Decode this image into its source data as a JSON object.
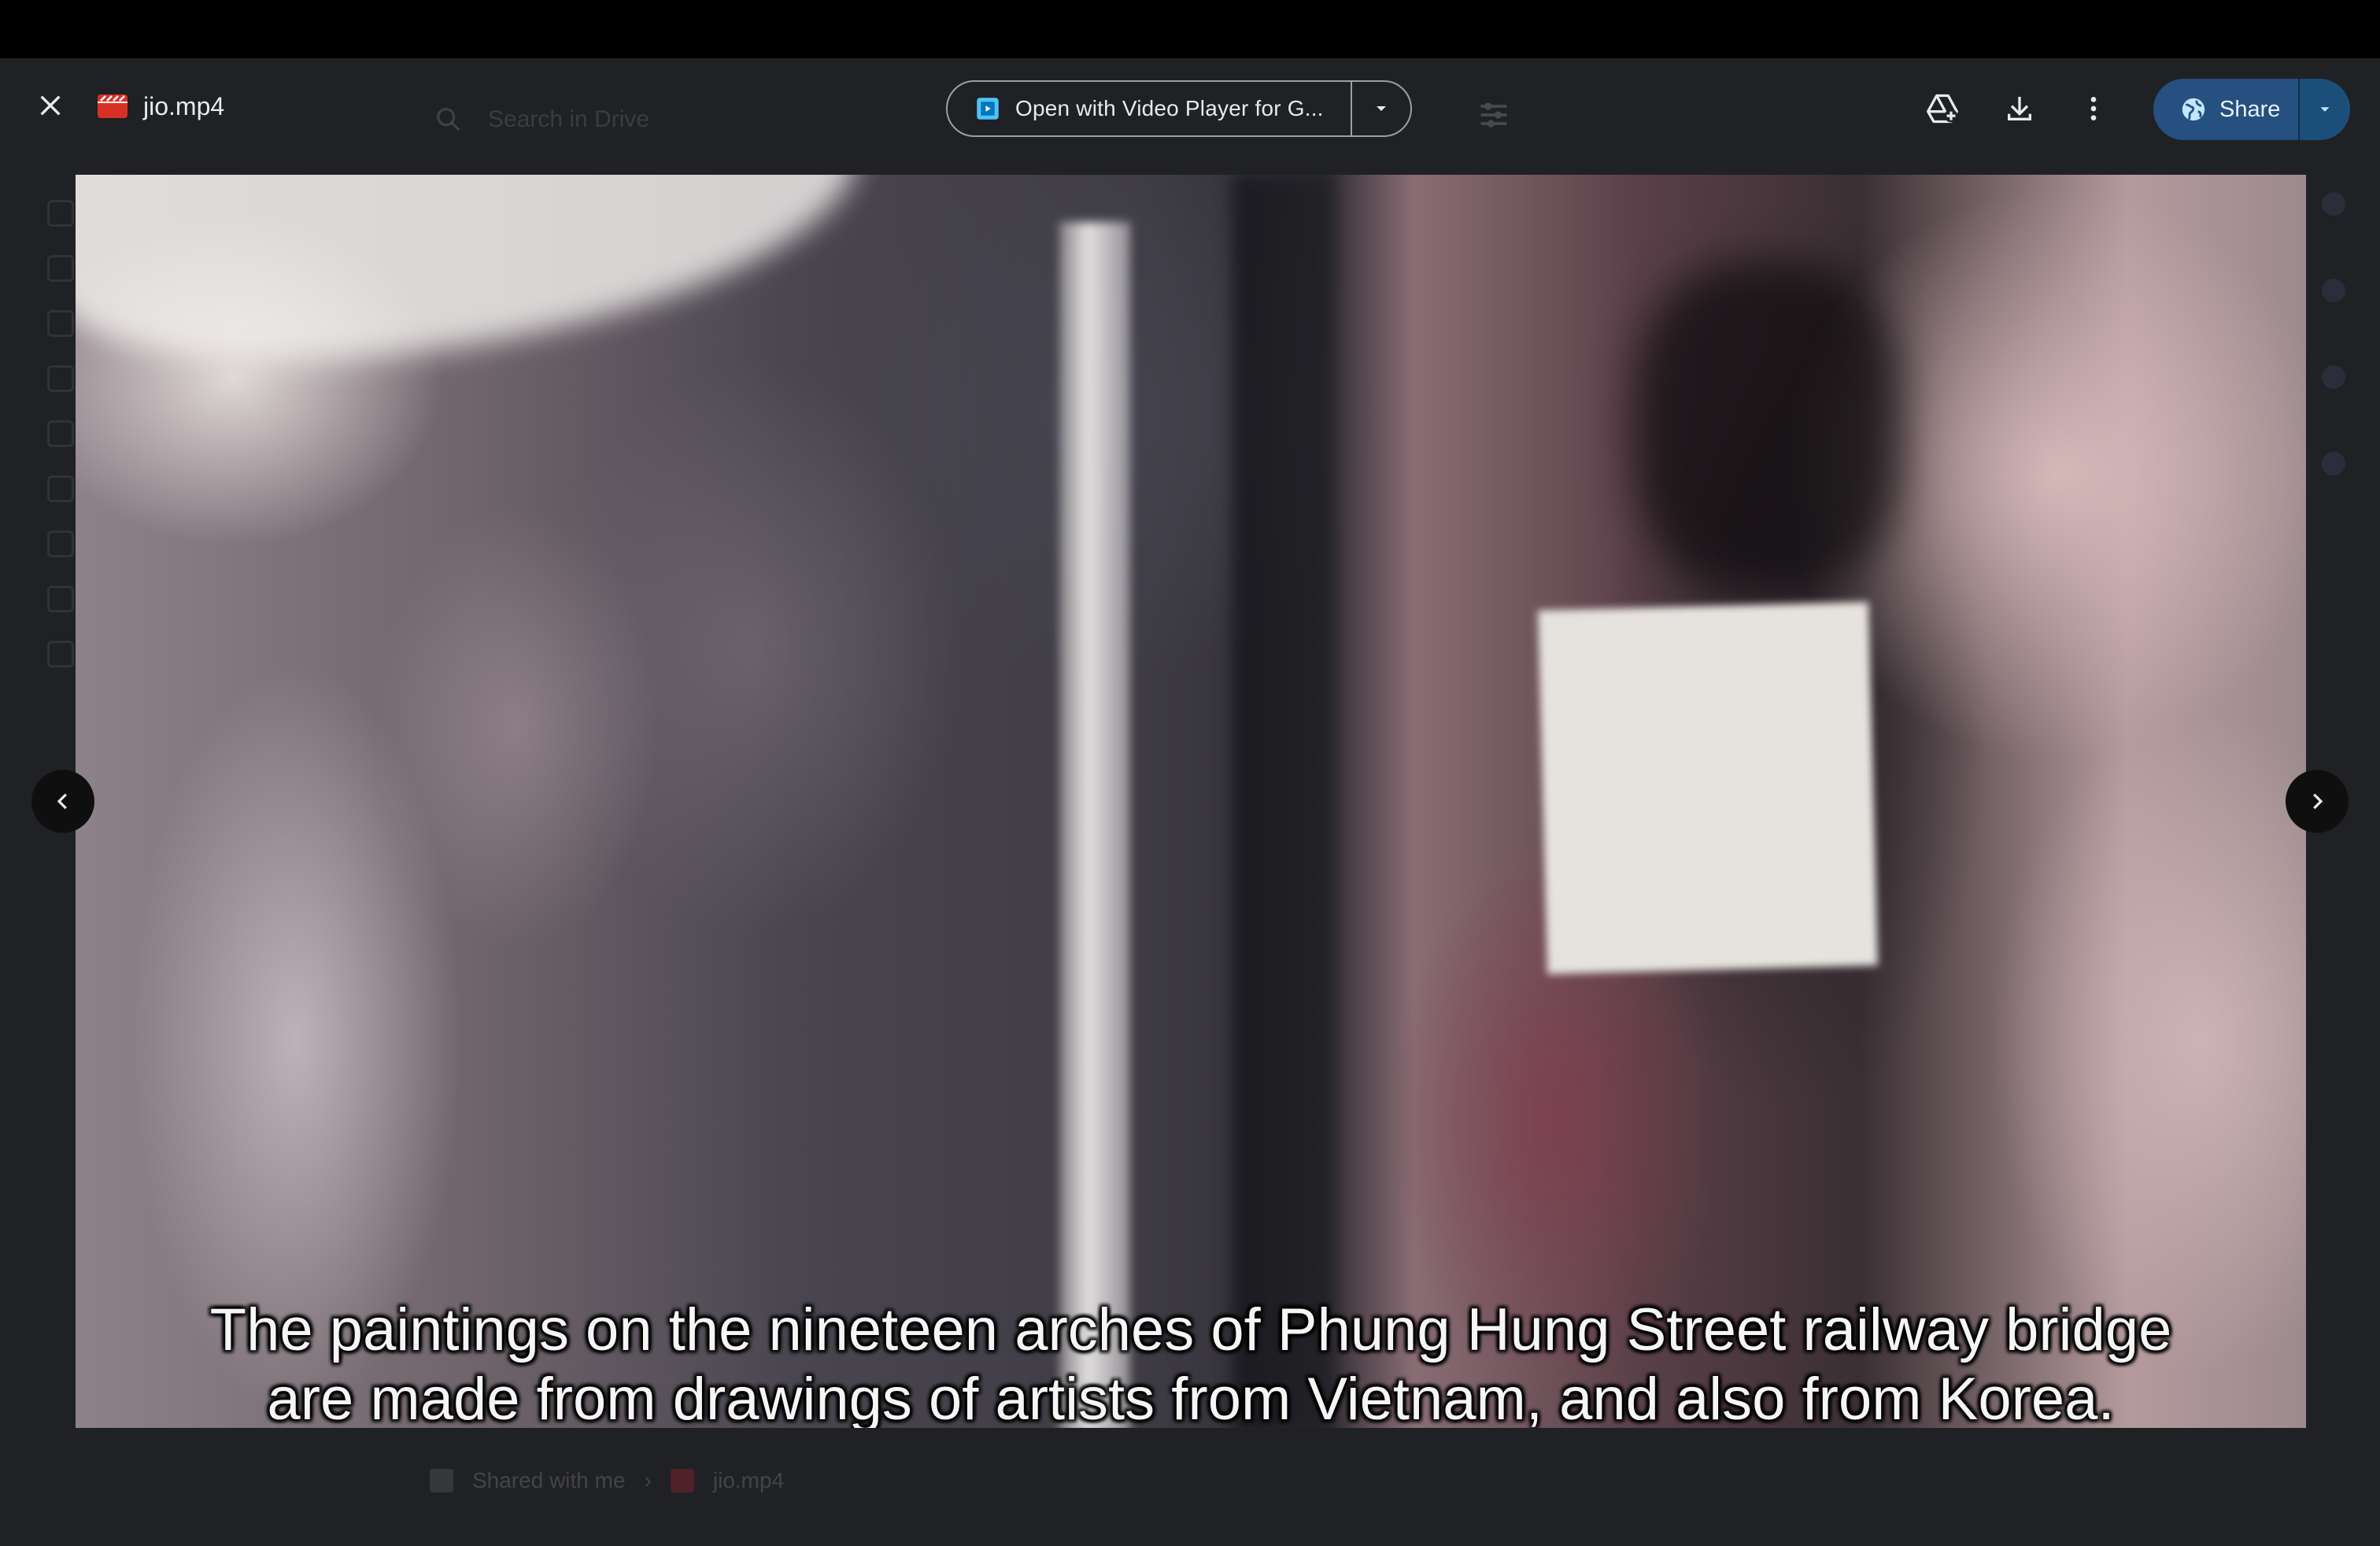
{
  "file": {
    "name": "jio.mp4"
  },
  "search": {
    "placeholder": "Search in Drive"
  },
  "open_with": {
    "label": "Open with Video Player for G..."
  },
  "share": {
    "label": "Share"
  },
  "video": {
    "subtitle_line1": "The paintings on the nineteen arches of Phung Hung Street railway bridge",
    "subtitle_line2": "are made from drawings of artists from Vietnam, and also from Korea."
  },
  "breadcrumb": {
    "items": [
      "Shared with me",
      "jio.mp4"
    ]
  },
  "icons": {
    "close": "close-icon",
    "file": "video-file-icon",
    "open_with_app": "video-player-app-icon",
    "dropdown": "chevron-down-icon",
    "add_to_drive": "add-to-drive-icon",
    "download": "download-icon",
    "more": "more-vert-icon",
    "share_globe": "globe-icon",
    "prev": "chevron-left-icon",
    "next": "chevron-right-icon"
  },
  "colors": {
    "background": "#202124",
    "share_button": "#25507f",
    "file_icon": "#d93025",
    "app_icon": "#4fc3f7"
  }
}
